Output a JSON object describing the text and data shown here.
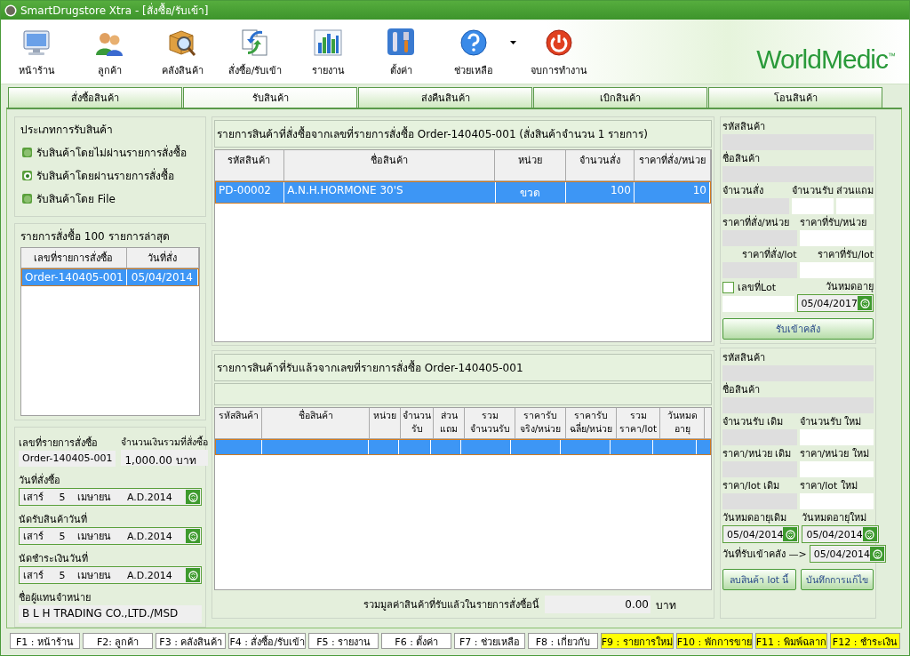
{
  "window": {
    "title": "SmartDrugstore Xtra - [สั่งซื้อ/รับเข้า]"
  },
  "toolbar": [
    {
      "label": "หน้าร้าน",
      "menu": false
    },
    {
      "label": "ลูกค้า",
      "menu": false
    },
    {
      "label": "คลังสินค้า",
      "menu": false
    },
    {
      "label": "สั่งซื้อ/รับเข้า",
      "menu": false
    },
    {
      "label": "รายงาน",
      "menu": false
    },
    {
      "label": "ตั้งค่า",
      "menu": false
    },
    {
      "label": "ช่วยเหลือ",
      "menu": true
    },
    {
      "label": "จบการทำงาน",
      "menu": false
    }
  ],
  "logo": {
    "name": "WorldMedic",
    "mark": "™"
  },
  "tabs": [
    {
      "label": "สั่งซื้อสินค้า",
      "selected": false
    },
    {
      "label": "รับสินค้า",
      "selected": true
    },
    {
      "label": "ส่งคืนสินค้า",
      "selected": false
    },
    {
      "label": "เบิกสินค้า",
      "selected": false
    },
    {
      "label": "โอนสินค้า",
      "selected": false
    }
  ],
  "receive_type": {
    "title": "ประเภทการรับสินค้า",
    "options": [
      {
        "label": "รับสินค้าโดยไม่ผ่านรายการสั่งซื้อ",
        "selected": false
      },
      {
        "label": "รับสินค้าโดยผ่านรายการสั่งซื้อ",
        "selected": true
      },
      {
        "label": "รับสินค้าโดย File",
        "selected": false
      }
    ]
  },
  "recent_orders": {
    "title": "รายการสั่งซื้อ 100 รายการล่าสุด",
    "columns": [
      "เลขที่รายการสั่งซื้อ",
      "วันที่สั่ง"
    ],
    "rows": [
      {
        "cells": [
          "Order-140405-001",
          "05/04/2014"
        ],
        "selected": true
      }
    ]
  },
  "order_info": {
    "order_no": {
      "label": "เลขที่รายการสั่งซื้อ",
      "value": "Order-140405-001"
    },
    "total": {
      "label": "จำนวนเงินรวมที่สั่งซื้อ",
      "value": "1,000.00 บาท"
    },
    "dates": [
      {
        "label": "วันที่สั่งซื้อ",
        "value": "เสาร์     5    เมษายน     A.D.2014"
      },
      {
        "label": "นัดรับสินค้าวันที่",
        "value": "เสาร์     5    เมษายน     A.D.2014"
      },
      {
        "label": "นัดชำระเงินวันที่",
        "value": "เสาร์     5    เมษายน     A.D.2014"
      }
    ],
    "supplier": {
      "label": "ชื่อผู้แทนจำหน่าย",
      "value": "B L H TRADING CO.,LTD./MSD"
    }
  },
  "ordered_items": {
    "title": "รายการสินค้าที่สั่งซื้อจากเลขที่รายการสั่งซื้อ Order-140405-001 (สั่งสินค้าจำนวน 1 รายการ)",
    "columns": [
      "รหัสสินค้า",
      "ชื่อสินค้า",
      "หน่วย",
      "จำนวนสั่ง",
      "ราคาที่สั่ง/หน่วย"
    ],
    "rows": [
      {
        "cells": [
          "PD-00002",
          "A.N.H.HORMONE 30'S",
          "ขวด",
          "100",
          "10"
        ],
        "selected": true
      }
    ]
  },
  "received_items": {
    "title": "รายการสินค้าที่รับแล้วจากเลขที่รายการสั่งซื้อ Order-140405-001",
    "columns": [
      "รหัสสินค้า",
      "ชื่อสินค้า",
      "หน่วย",
      "จำนวน\nรับ",
      "ส่วน\nแถม",
      "รวม\nจำนวนรับ",
      "ราคารับ\nจริง/หน่วย",
      "ราคารับ\nฉลี่ย/หน่วย",
      "รวม\nราคา/lot",
      "วันหมด\nอายุ"
    ],
    "rows": [
      {
        "selected": true
      }
    ]
  },
  "received_total": {
    "label": "รวมมูลค่าสินค้าที่รับแล้วในรายการสั่งซื้อนี้",
    "value": "0.00",
    "unit": "บาท"
  },
  "receive_form": {
    "rows": [
      [
        {
          "label": "รหัสสินค้า",
          "disabled": true
        }
      ],
      [
        {
          "label": "ชื่อสินค้า",
          "disabled": true
        }
      ],
      [
        {
          "label": "จำนวนสั่ง",
          "disabled": true
        },
        {
          "label": "จำนวนรับ",
          "disabled": false
        },
        {
          "label": "ส่วนแถม",
          "disabled": false
        }
      ],
      [
        {
          "label": "ราคาที่สั่ง/หน่วย",
          "disabled": true
        },
        {
          "label": "ราคาที่รับ/หน่วย",
          "disabled": false
        }
      ],
      [
        {
          "label": "ราคาที่สั่ง/lot",
          "disabled": true
        },
        {
          "label": "ราคาที่รับ/lot",
          "disabled": false
        }
      ]
    ],
    "lot": {
      "label": "เลขที่Lot",
      "checked": false
    },
    "expiry": {
      "label": "วันหมดอายุ",
      "value": "05/04/2017"
    },
    "button": "รับเข้าคลัง"
  },
  "edit_form": {
    "rows": [
      [
        {
          "label": "รหัสสินค้า",
          "disabled": true
        }
      ],
      [
        {
          "label": "ชื่อสินค้า",
          "disabled": true
        }
      ],
      [
        {
          "label": "จำนวนรับ เดิม",
          "disabled": true
        },
        {
          "label": "จำนวนรับ ใหม่",
          "disabled": false
        }
      ],
      [
        {
          "label": "ราคา/หน่วย เดิม",
          "disabled": true
        },
        {
          "label": "ราคา/หน่วย ใหม่",
          "disabled": false
        }
      ],
      [
        {
          "label": "ราคา/lot เดิม",
          "disabled": true
        },
        {
          "label": "ราคา/lot ใหม่",
          "disabled": false
        }
      ]
    ],
    "expiry_old": {
      "label": "วันหมดอายุเดิม",
      "value": "05/04/2014"
    },
    "expiry_new": {
      "label": "วันหมดอายุใหม่",
      "value": "05/04/2014"
    },
    "received_date": {
      "label": "วันที่รับเข้าคลัง —>",
      "value": "05/04/2014"
    },
    "buttons": [
      "ลบสินค้า lot นี้",
      "บันทึกการแก้ไข"
    ]
  },
  "function_keys": [
    {
      "label": "F1 : หน้าร้าน",
      "highlighted": false
    },
    {
      "label": "F2: ลูกค้า",
      "highlighted": false
    },
    {
      "label": "F3 : คลังสินค้า",
      "highlighted": false
    },
    {
      "label": "F4 : สั่งซื้อ/รับเข้า",
      "highlighted": false
    },
    {
      "label": "F5 : รายงาน",
      "highlighted": false
    },
    {
      "label": "F6 : ตั้งค่า",
      "highlighted": false
    },
    {
      "label": "F7 : ช่วยเหลือ",
      "highlighted": false
    },
    {
      "label": "F8 : เกี่ยวกับ",
      "highlighted": false
    },
    {
      "label": "F9 : รายการใหม่",
      "highlighted": true
    },
    {
      "label": "F10 : พักการขาย",
      "highlighted": true
    },
    {
      "label": "F11 : พิมพ์ฉลาก",
      "highlighted": true
    },
    {
      "label": "F12 : ชำระเงิน",
      "highlighted": true
    }
  ]
}
